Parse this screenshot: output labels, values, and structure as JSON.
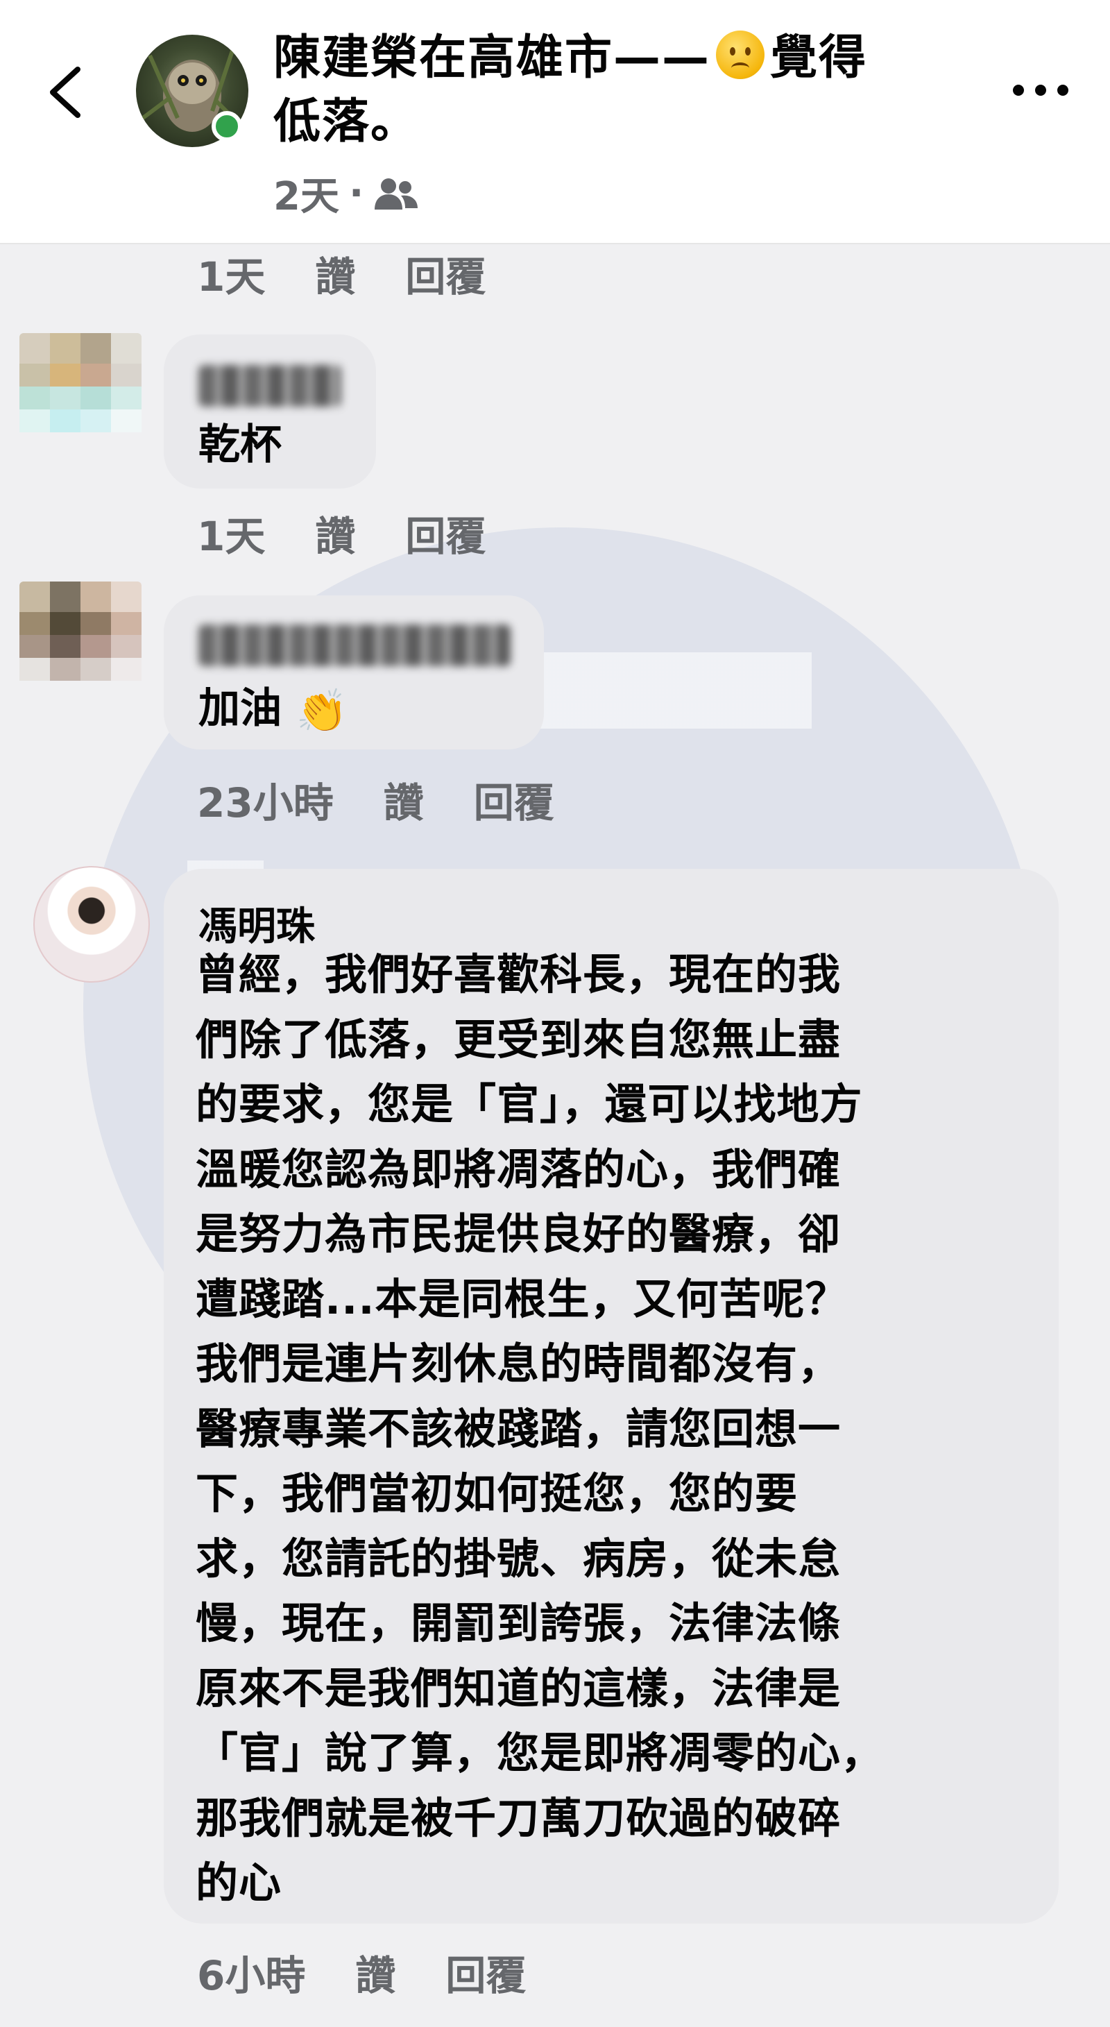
{
  "header": {
    "title_part1": "陳建榮在高雄市——",
    "feeling_icon": "sad-face-emoji",
    "title_part2": "覺得",
    "title_line2": "低落。",
    "meta_time": "2天",
    "meta_sep": "·",
    "audience_icon": "friends-icon"
  },
  "actions": {
    "like": "讚",
    "reply": "回覆"
  },
  "comments": [
    {
      "time": "1天"
    },
    {
      "name_hidden": true,
      "text": "乾杯",
      "time": "1天"
    },
    {
      "name_hidden": true,
      "text": "加油",
      "emoji": "👏",
      "time": "23小時"
    },
    {
      "name": "馮明珠",
      "text": "曾經，我們好喜歡科長，現在的我\n們除了低落，更受到來自您無止盡\n的要求，您是「官」，還可以找地方\n溫暖您認為即將凋落的心，我們確\n是努力為市民提供良好的醫療，卻\n遭踐踏...本是同根生，又何苦呢？\n我們是連片刻休息的時間都沒有，\n醫療專業不該被踐踏，請您回想一\n下，我們當初如何挺您，您的要\n求，您請託的掛號、病房，從未怠\n慢，現在，開罰到誇張，法律法條\n原來不是我們知道的這樣，法律是\n「官」說了算，您是即將凋零的心，\n那我們就是被千刀萬刀砍過的破碎\n的心",
      "time": "6小時"
    }
  ]
}
